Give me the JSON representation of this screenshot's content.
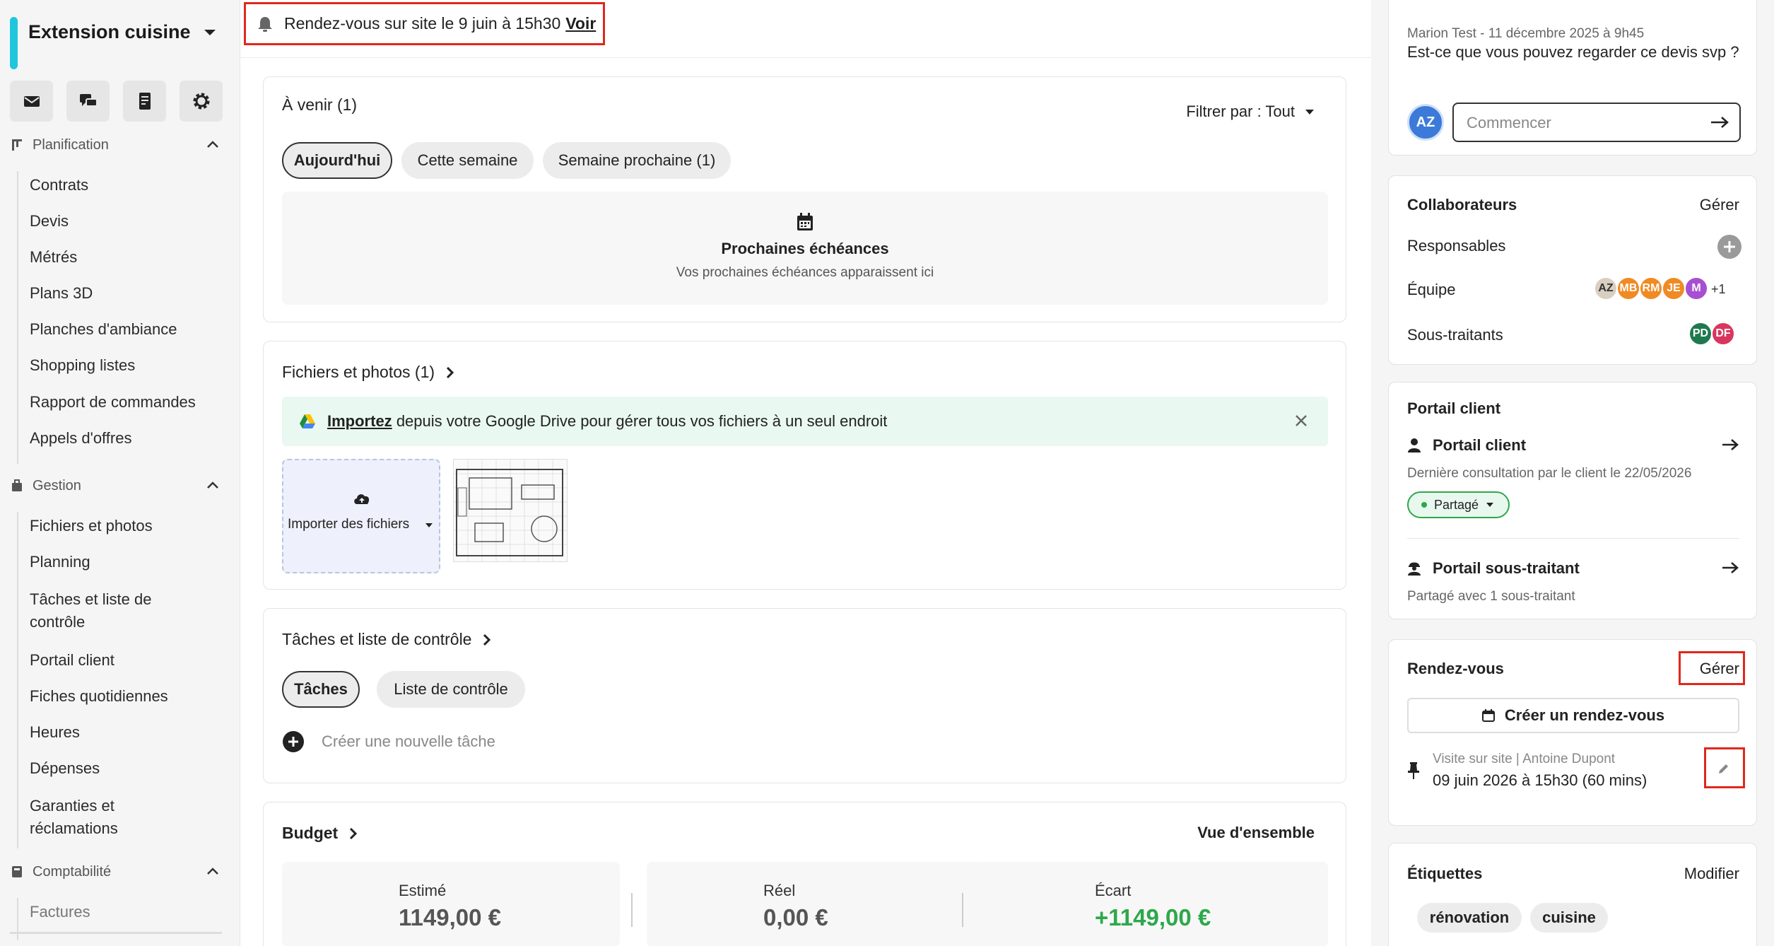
{
  "sidebar": {
    "project_name": "Extension cuisine",
    "sections": [
      {
        "label": "Planification",
        "items": [
          "Contrats",
          "Devis",
          "Métrés",
          "Plans 3D",
          "Planches d'ambiance",
          "Shopping listes",
          "Rapport de commandes",
          "Appels d'offres"
        ]
      },
      {
        "label": "Gestion",
        "items": [
          "Fichiers et photos",
          "Planning",
          "Tâches et liste de contrôle",
          "Portail client",
          "Fiches quotidiennes",
          "Heures",
          "Dépenses",
          "Garanties et réclamations"
        ]
      },
      {
        "label": "Comptabilité",
        "items": [
          "Factures"
        ]
      }
    ]
  },
  "alert": {
    "text": "Rendez-vous sur site le 9 juin à 15h30",
    "link": "Voir"
  },
  "upcoming": {
    "title": "À venir (1)",
    "filter": "Filtrer par : Tout",
    "tabs": [
      "Aujourd'hui",
      "Cette semaine",
      "Semaine prochaine (1)"
    ],
    "empty_title": "Prochaines échéances",
    "empty_sub": "Vos prochaines échéances apparaissent ici"
  },
  "files": {
    "title": "Fichiers et photos (1)",
    "banner_link": "Importez",
    "banner_text": "depuis votre Google Drive pour gérer tous vos fichiers à un seul endroit",
    "import_label": "Importer des fichiers"
  },
  "tasks": {
    "title": "Tâches et liste de contrôle",
    "tabs": [
      "Tâches",
      "Liste de contrôle"
    ],
    "new_task": "Créer une nouvelle tâche"
  },
  "budget": {
    "title": "Budget",
    "overview": "Vue d'ensemble",
    "estimated_label": "Estimé",
    "estimated_value": "1149,00 €",
    "real_label": "Réel",
    "real_value": "0,00 €",
    "gap_label": "Écart",
    "gap_value": "+1149,00 €",
    "gap_color": "#2da84a"
  },
  "messages": {
    "meta": "Marion Test - 11 décembre 2025 à 9h45",
    "text": "Est-ce que vous pouvez regarder ce devis svp ?",
    "avatar": "AZ",
    "input_placeholder": "Commencer"
  },
  "collaborators": {
    "title": "Collaborateurs",
    "manage": "Gérer",
    "responsables_label": "Responsables",
    "team_label": "Équipe",
    "team": [
      {
        "initials": "AZ",
        "color": "#d9cfc0"
      },
      {
        "initials": "MB",
        "color": "#f08a24"
      },
      {
        "initials": "RM",
        "color": "#f08a24"
      },
      {
        "initials": "JE",
        "color": "#f08a24"
      },
      {
        "initials": "M",
        "color": "#a74fd1"
      }
    ],
    "team_more": "+1",
    "subcontractors_label": "Sous-traitants",
    "subcontractors": [
      {
        "initials": "PD",
        "color": "#1e7a4e"
      },
      {
        "initials": "DF",
        "color": "#d8365f"
      }
    ]
  },
  "portal": {
    "title": "Portail client",
    "client_label": "Portail client",
    "client_sub": "Dernière consultation par le client le 22/05/2026",
    "shared": "Partagé",
    "sub_label": "Portail sous-traitant",
    "sub_sub": "Partagé avec 1 sous-traitant"
  },
  "appointments": {
    "title": "Rendez-vous",
    "manage": "Gérer",
    "create": "Créer un rendez-vous",
    "item_meta": "Visite sur site | Antoine Dupont",
    "item_date": "09 juin 2026 à 15h30 (60 mins)"
  },
  "tags": {
    "title": "Étiquettes",
    "modify": "Modifier",
    "items": [
      "rénovation",
      "cuisine"
    ]
  }
}
